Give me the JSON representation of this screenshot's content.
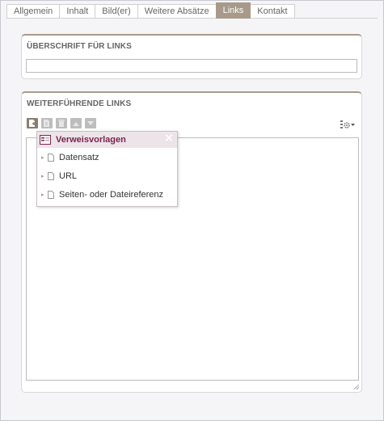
{
  "tabs": [
    {
      "label": "Allgemein",
      "active": false
    },
    {
      "label": "Inhalt",
      "active": false
    },
    {
      "label": "Bild(er)",
      "active": false
    },
    {
      "label": "Weitere Absätze",
      "active": false
    },
    {
      "label": "Links",
      "active": true
    },
    {
      "label": "Kontakt",
      "active": false
    }
  ],
  "heading_section": {
    "title": "ÜBERSCHRIFT FÜR LINKS",
    "input_value": ""
  },
  "links_section": {
    "title": "WEITERFÜHRENDE LINKS",
    "toolbar": [
      {
        "icon": "new-link-icon",
        "enabled": true
      },
      {
        "icon": "edit-icon",
        "enabled": false
      },
      {
        "icon": "delete-icon",
        "enabled": false
      },
      {
        "icon": "arrow-up-icon",
        "enabled": false
      },
      {
        "icon": "arrow-down-icon",
        "enabled": false
      }
    ],
    "settings_icon": "gear-dropdown-icon"
  },
  "popup": {
    "title": "Verweisvorlagen",
    "close_glyph": "✕",
    "items": [
      {
        "label": "Datensatz"
      },
      {
        "label": "URL"
      },
      {
        "label": "Seiten- oder Dateireferenz"
      }
    ]
  },
  "colors": {
    "accent": "#a89a8a",
    "popup_title": "#7b2450",
    "popup_header_bg": "#ece4e9"
  }
}
